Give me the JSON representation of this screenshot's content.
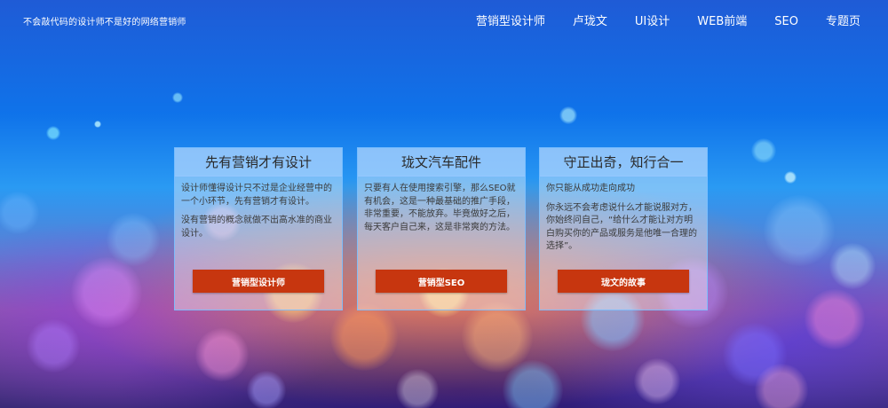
{
  "header": {
    "slogan": "不会敲代码的设计师不是好的网络营销师"
  },
  "nav": {
    "items": [
      {
        "label": "营销型设计师"
      },
      {
        "label": "卢珑文"
      },
      {
        "label": "UI设计"
      },
      {
        "label": "WEB前端"
      },
      {
        "label": "SEO"
      },
      {
        "label": "专题页"
      }
    ]
  },
  "cards": [
    {
      "title": "先有营销才有设计",
      "paragraphs": [
        "设计师懂得设计只不过是企业经营中的一个小环节，先有营销才有设计。",
        "没有营销的概念就做不出高水准的商业设计。"
      ],
      "button": "营销型设计师"
    },
    {
      "title": "珑文汽车配件",
      "paragraphs": [
        "只要有人在使用搜索引擎，那么SEO就有机会，这是一种最基础的推广手段，非常重要，不能放弃。毕竟做好之后，每天客户自己来，这是非常爽的方法。"
      ],
      "button": "营销型SEO"
    },
    {
      "title": "守正出奇，知行合一",
      "paragraphs": [
        "你只能从成功走向成功",
        "你永远不会考虑说什么才能说服对方，你始终问自己，“给什么才能让对方明白购买你的产品或服务是他唯一合理的选择”。"
      ],
      "button": "珑文的故事"
    }
  ],
  "colors": {
    "button_bg": "#c7360f",
    "card_border": "#78beff",
    "sky_top": "#1f5bd6"
  }
}
